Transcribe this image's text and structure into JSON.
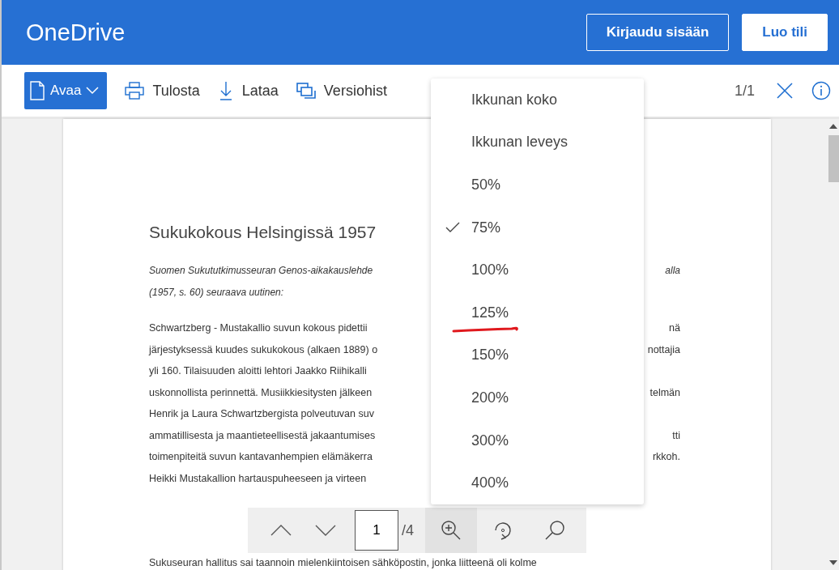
{
  "header": {
    "app_name": "OneDrive",
    "buttons": [
      {
        "label": "Kirjaudu sisään",
        "kind": "outline"
      },
      {
        "label": "Luo tili",
        "kind": "solid"
      }
    ]
  },
  "toolbar": {
    "open_button": {
      "label": "Avaa"
    },
    "actions": [
      {
        "label": "Tulosta",
        "kind": "print"
      },
      {
        "label": "Lataa",
        "kind": "download"
      },
      {
        "label": "Versiohist",
        "kind": "versions"
      }
    ],
    "page_count": "1/1"
  },
  "document": {
    "title": "Sukukokous Helsingissä 1957",
    "intro_lines": [
      {
        "left": "Suomen Sukututkimusseuran Genos-aikakauslehde",
        "right": "alla"
      },
      {
        "left": "(1957, s. 60) seuraava uutinen:"
      }
    ],
    "body_lines": [
      {
        "left": "Schwartzberg - Mustakallio suvun kokous pidettii",
        "right": "nä"
      },
      {
        "left": "järjestyksessä kuudes sukukokous (alkaen 1889) o",
        "right": "nottajia"
      },
      {
        "left": "yli 160. Tilaisuuden aloitti lehtori Jaakko Riihikalli"
      },
      {
        "left": "uskonnollista perinnettä. Musiikkiesitysten jälkeen",
        "right": "telmän"
      },
      {
        "left": "Henrik ja Laura Schwartzbergista polveutuvan suv"
      },
      {
        "left": "ammatillisesta ja maantieteellisestä jakaantumises",
        "right": "tti"
      },
      {
        "left": "toimenpiteitä suvun kantavanhempien elämäkerra",
        "right": "rkkoh."
      },
      {
        "left": "Heikki Mustakallion hartauspuheeseen ja virteen"
      }
    ],
    "last_line": "Sukuseuran hallitus sai taannoin mielenkiintoisen sähköpostin, jonka liitteenä oli kolme"
  },
  "zoom_menu": {
    "items": [
      {
        "label": "Ikkunan koko",
        "checked": false
      },
      {
        "label": "Ikkunan leveys",
        "checked": false
      },
      {
        "label": "50%",
        "checked": false
      },
      {
        "label": "75%",
        "checked": true
      },
      {
        "label": "100%",
        "checked": false
      },
      {
        "label": "125%",
        "checked": false,
        "underlined": true
      },
      {
        "label": "150%",
        "checked": false
      },
      {
        "label": "200%",
        "checked": false
      },
      {
        "label": "300%",
        "checked": false
      },
      {
        "label": "400%",
        "checked": false
      }
    ]
  },
  "page_nav": {
    "page": "1",
    "total": "/4"
  }
}
